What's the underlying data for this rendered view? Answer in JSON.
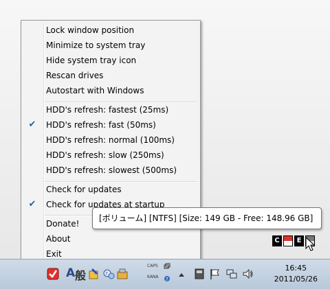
{
  "menu": {
    "group1": [
      {
        "label": "Lock window position",
        "checked": false
      },
      {
        "label": "Minimize to system tray",
        "checked": false
      },
      {
        "label": "Hide system tray icon",
        "checked": false
      },
      {
        "label": "Rescan drives",
        "checked": false
      },
      {
        "label": "Autostart with Windows",
        "checked": false
      }
    ],
    "group2": [
      {
        "label": "HDD's refresh: fastest (25ms)",
        "checked": false
      },
      {
        "label": "HDD's refresh: fast (50ms)",
        "checked": true
      },
      {
        "label": "HDD's refresh: normal (100ms)",
        "checked": false
      },
      {
        "label": "HDD's refresh: slow (250ms)",
        "checked": false
      },
      {
        "label": "HDD's refresh: slowest (500ms)",
        "checked": false
      }
    ],
    "group3": [
      {
        "label": "Check for updates",
        "checked": false
      },
      {
        "label": "Check for updates at startup",
        "checked": true
      }
    ],
    "group4": [
      {
        "label": "Donate!",
        "checked": false
      },
      {
        "label": "About",
        "checked": false
      },
      {
        "label": "Exit",
        "checked": false
      }
    ],
    "check_glyph": "✔"
  },
  "tooltip": {
    "text": "[ボリューム] [NTFS] [Size: 149 GB - Free: 148.96 GB]"
  },
  "overlay": {
    "letters": [
      "C",
      "",
      "E",
      ""
    ]
  },
  "taskbar": {
    "ime_a": "A",
    "ime_mode": "般",
    "caps": "CAPS",
    "kana": "KANA",
    "time": "16:45",
    "date": "2011/05/26"
  },
  "colors": {
    "accent": "#2a5bb0",
    "overlay_red": "#e0322c"
  }
}
